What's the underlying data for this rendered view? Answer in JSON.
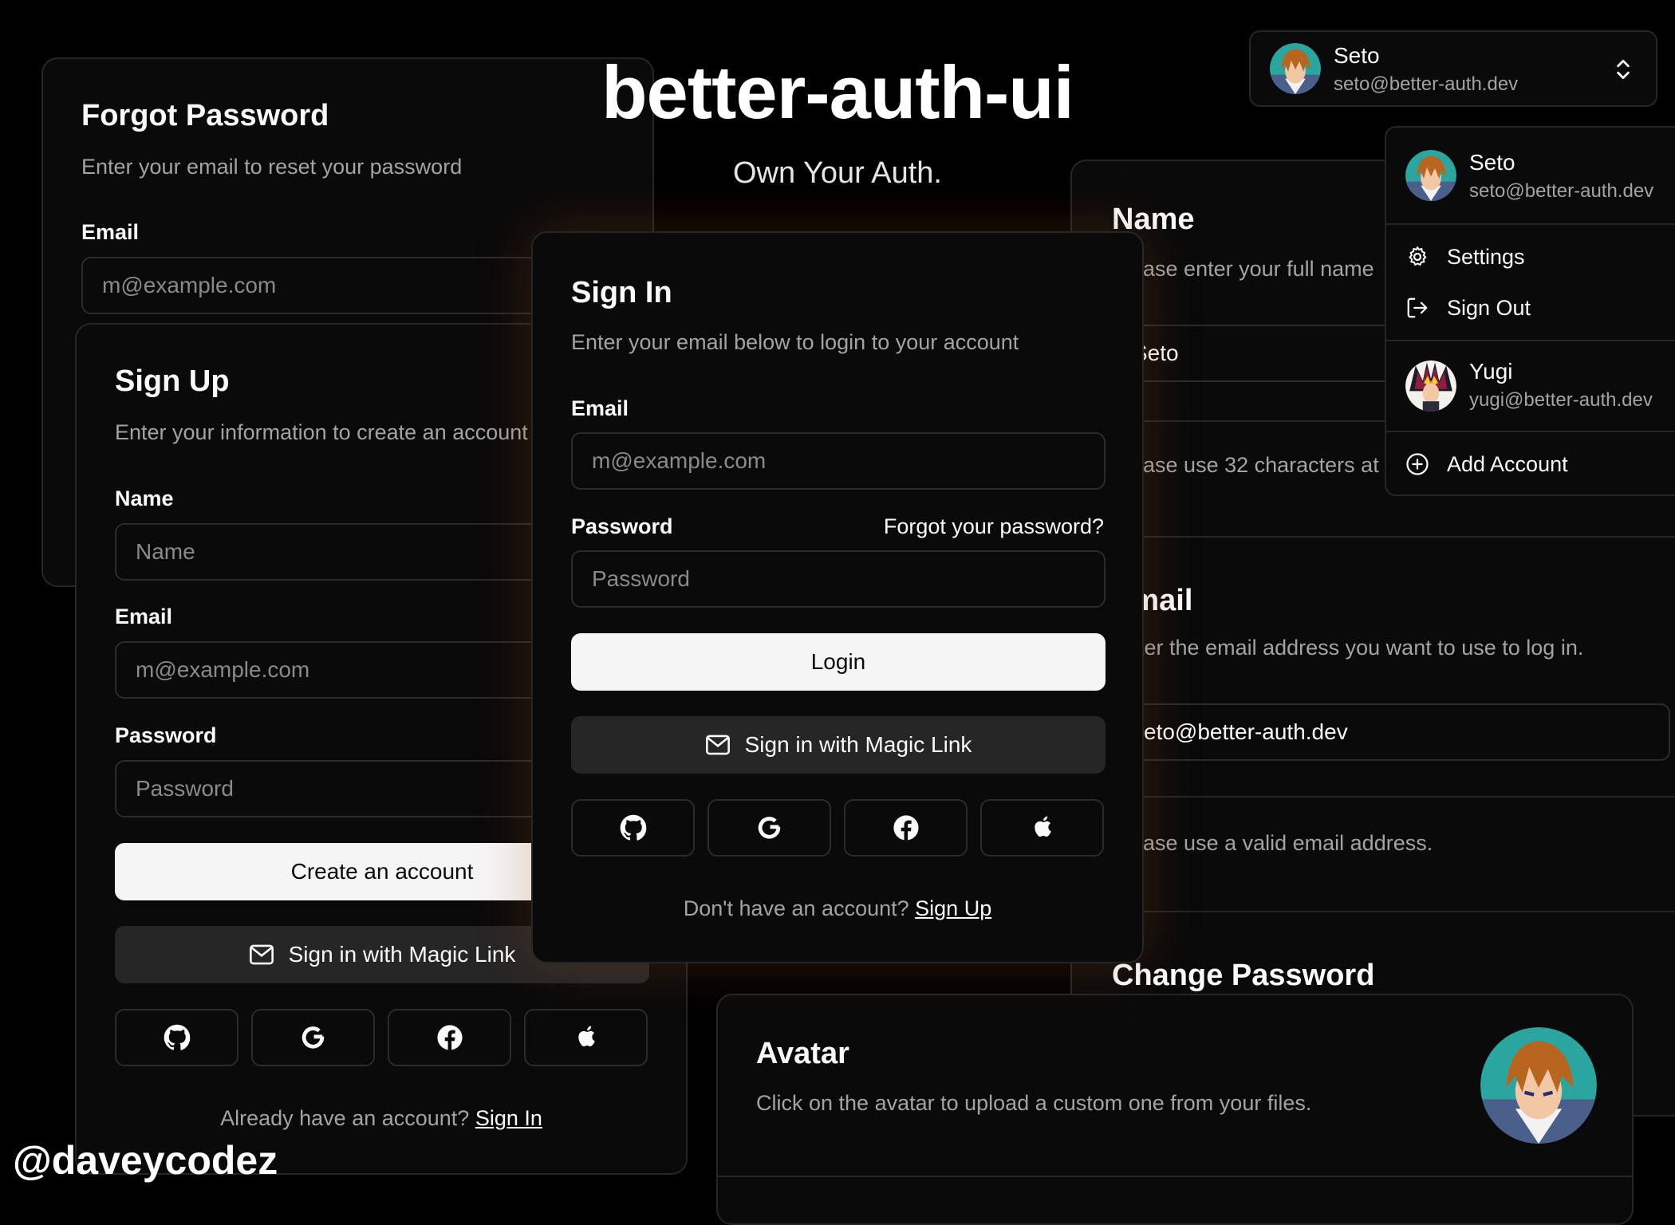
{
  "hero": {
    "title": "better-auth-ui",
    "subtitle": "Own Your Auth.",
    "credit": "@daveycodez"
  },
  "forgot": {
    "title": "Forgot Password",
    "description": "Enter your email to reset your password",
    "email_label": "Email",
    "email_placeholder": "m@example.com"
  },
  "signup": {
    "title": "Sign Up",
    "description": "Enter your information to create an account",
    "name_label": "Name",
    "name_placeholder": "Name",
    "email_label": "Email",
    "email_placeholder": "m@example.com",
    "password_label": "Password",
    "password_placeholder": "Password",
    "create_label": "Create an account",
    "magic_label": "Sign in with Magic Link",
    "footer_text": "Already have an account?",
    "footer_link": "Sign In"
  },
  "signin": {
    "title": "Sign In",
    "description": "Enter your email below to login to your account",
    "email_label": "Email",
    "email_placeholder": "m@example.com",
    "password_label": "Password",
    "forgot_link": "Forgot your password?",
    "password_placeholder": "Password",
    "login_label": "Login",
    "magic_label": "Sign in with Magic Link",
    "footer_text": "Don't have an account?",
    "footer_link": "Sign Up"
  },
  "settings": {
    "name_title": "Name",
    "name_desc": "Please enter your full name",
    "name_value": "Seto",
    "name_hint": "Please use 32 characters at maximum.",
    "email_title": "Email",
    "email_desc": "Enter the email address you want to use to log in.",
    "email_value": "seto@better-auth.dev",
    "email_hint": "Please use a valid email address.",
    "password_title": "Change Password"
  },
  "avatar_card": {
    "title": "Avatar",
    "description": "Click on the avatar to upload a custom one from your files."
  },
  "user_button": {
    "name": "Seto",
    "email": "seto@better-auth.dev"
  },
  "dropdown": {
    "current": {
      "name": "Seto",
      "email": "seto@better-auth.dev"
    },
    "settings_label": "Settings",
    "signout_label": "Sign Out",
    "other": {
      "name": "Yugi",
      "email": "yugi@better-auth.dev"
    },
    "add_label": "Add Account"
  },
  "colors": {
    "background": "#000000",
    "card": "#0a0a0a",
    "border": "#262626",
    "muted": "#a3a3a3",
    "primary_button": "#f5f5f5",
    "seto_hair": "#b8651f",
    "yugi_hair": "#8e1e3c"
  }
}
